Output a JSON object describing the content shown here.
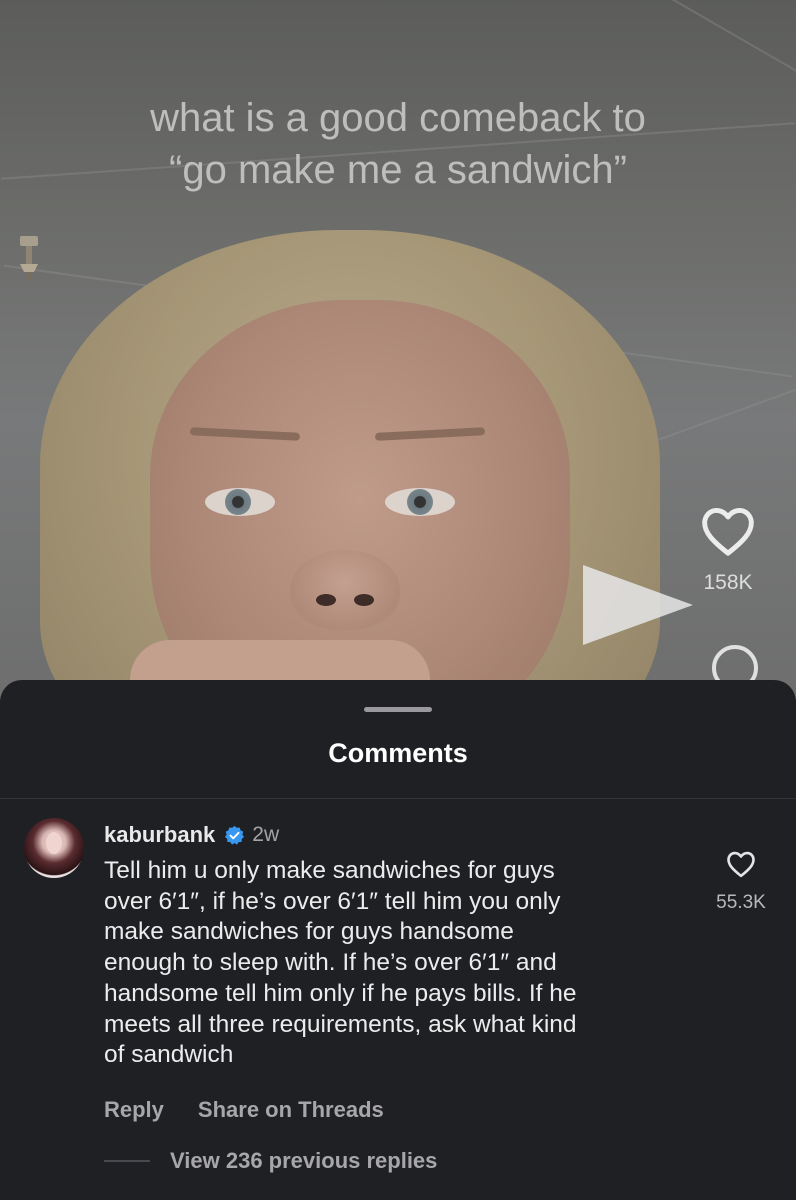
{
  "video": {
    "caption_line1": "what is a good comeback to",
    "caption_line2": "“go make me a sandwich”",
    "like_count": "158K",
    "icons": [
      "heart-icon",
      "comment-icon",
      "share-icon"
    ]
  },
  "comments_sheet": {
    "title": "Comments",
    "comment": {
      "username": "kaburbank",
      "verified": true,
      "time": "2w",
      "text": "Tell him u only make sandwiches for guys\nover 6′1″, if he’s over 6′1″ tell him you only\nmake sandwiches for guys handsome\nenough to sleep with. If he’s over 6′1″ and\nhandsome tell him only if he pays bills. If he\nmeets all three requirements, ask what kind\nof sandwich",
      "like_count": "55.3K",
      "reply_label": "Reply",
      "share_label": "Share on Threads"
    },
    "replies_label": "View 236 previous replies"
  },
  "colors": {
    "sheet_bg": "#1f2024",
    "verified_blue": "#3897f0",
    "secondary_text": "#a6a6ab"
  }
}
